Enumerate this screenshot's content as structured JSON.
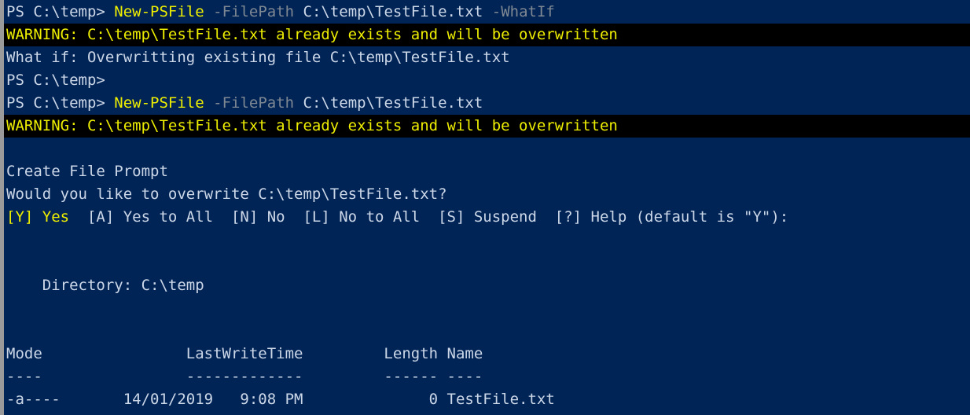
{
  "terminal": {
    "name": "powershell-console",
    "background_color": "#012456",
    "foreground_color": "#ccd7e8",
    "warning_background_color": "#000000",
    "warning_foreground_color": "#EEEE00",
    "command_color": "#EEEE00",
    "parameter_color": "#7e8893",
    "border_color": "#9a9a9a"
  },
  "lines": [
    {
      "id": "line-1-command-whatif",
      "type": "command",
      "segments": [
        {
          "text": "PS C:\\temp> ",
          "style": "seg-white"
        },
        {
          "text": "New-PSFile",
          "style": "seg-command"
        },
        {
          "text": " ",
          "style": "seg-white"
        },
        {
          "text": "-FilePath",
          "style": "seg-param"
        },
        {
          "text": " C:\\temp\\TestFile.txt ",
          "style": "seg-white"
        },
        {
          "text": "-WhatIf",
          "style": "seg-param"
        }
      ]
    },
    {
      "id": "line-2-warning-whatif",
      "type": "warning",
      "segments": [
        {
          "text": "WARNING: C:\\temp\\TestFile.txt already exists and will be overwritten",
          "style": "seg-warn"
        }
      ]
    },
    {
      "id": "line-3-whatif-output",
      "type": "output",
      "segments": [
        {
          "text": "What if: Overwritting existing file C:\\temp\\TestFile.txt",
          "style": "seg-white"
        }
      ]
    },
    {
      "id": "line-4-prompt-empty",
      "type": "prompt",
      "segments": [
        {
          "text": "PS C:\\temp>",
          "style": "seg-white"
        }
      ]
    },
    {
      "id": "line-5-command-run",
      "type": "command",
      "segments": [
        {
          "text": "PS C:\\temp> ",
          "style": "seg-white"
        },
        {
          "text": "New-PSFile",
          "style": "seg-command"
        },
        {
          "text": " ",
          "style": "seg-white"
        },
        {
          "text": "-FilePath",
          "style": "seg-param"
        },
        {
          "text": " C:\\temp\\TestFile.txt",
          "style": "seg-white"
        }
      ]
    },
    {
      "id": "line-6-warning-run",
      "type": "warning",
      "segments": [
        {
          "text": "WARNING: C:\\temp\\TestFile.txt already exists and will be overwritten",
          "style": "seg-warn"
        }
      ]
    },
    {
      "id": "line-7-blank",
      "type": "blank",
      "segments": [
        {
          "text": " ",
          "style": "seg-white"
        }
      ]
    },
    {
      "id": "line-8-prompt-caption",
      "type": "output",
      "segments": [
        {
          "text": "Create File Prompt",
          "style": "seg-white"
        }
      ]
    },
    {
      "id": "line-9-prompt-question",
      "type": "output",
      "segments": [
        {
          "text": "Would you like to overwrite C:\\temp\\TestFile.txt?",
          "style": "seg-white"
        }
      ]
    },
    {
      "id": "line-10-prompt-choices",
      "type": "choices",
      "segments": [
        {
          "text": "[Y] Yes",
          "style": "seg-choice-default"
        },
        {
          "text": "  [A] Yes to All  [N] No  [L] No to All  [S] Suspend  [?] Help (default is \"Y\"):",
          "style": "seg-white"
        }
      ]
    },
    {
      "id": "line-11-blank",
      "type": "blank",
      "segments": [
        {
          "text": " ",
          "style": "seg-white"
        }
      ]
    },
    {
      "id": "line-12-blank",
      "type": "blank",
      "segments": [
        {
          "text": " ",
          "style": "seg-white"
        }
      ]
    },
    {
      "id": "line-13-directory",
      "type": "output",
      "segments": [
        {
          "text": "    Directory: C:\\temp",
          "style": "seg-white"
        }
      ]
    },
    {
      "id": "line-14-blank",
      "type": "blank",
      "segments": [
        {
          "text": " ",
          "style": "seg-white"
        }
      ]
    },
    {
      "id": "line-15-blank",
      "type": "blank",
      "segments": [
        {
          "text": " ",
          "style": "seg-white"
        }
      ]
    },
    {
      "id": "line-16-table-header",
      "type": "table-header",
      "segments": [
        {
          "text": "Mode                LastWriteTime         Length Name",
          "style": "seg-white"
        }
      ]
    },
    {
      "id": "line-17-table-rule",
      "type": "table-rule",
      "segments": [
        {
          "text": "----                -------------         ------ ----",
          "style": "seg-white"
        }
      ]
    },
    {
      "id": "line-18-table-row",
      "type": "table-row",
      "segments": [
        {
          "text": "-a----       14/01/2019   9:08 PM              0 TestFile.txt",
          "style": "seg-white"
        }
      ]
    }
  ],
  "table": {
    "columns": [
      "Mode",
      "LastWriteTime",
      "Length",
      "Name"
    ],
    "rows": [
      {
        "mode": "-a----",
        "last_write_date": "14/01/2019",
        "last_write_time": "9:08 PM",
        "length": "0",
        "name": "TestFile.txt"
      }
    ]
  },
  "prompt": {
    "caption": "Create File Prompt",
    "message": "Would you like to overwrite C:\\temp\\TestFile.txt?",
    "default_choice": "Y",
    "choices": [
      {
        "key": "Y",
        "label": "Yes"
      },
      {
        "key": "A",
        "label": "Yes to All"
      },
      {
        "key": "N",
        "label": "No"
      },
      {
        "key": "L",
        "label": "No to All"
      },
      {
        "key": "S",
        "label": "Suspend"
      },
      {
        "key": "?",
        "label": "Help"
      }
    ]
  }
}
